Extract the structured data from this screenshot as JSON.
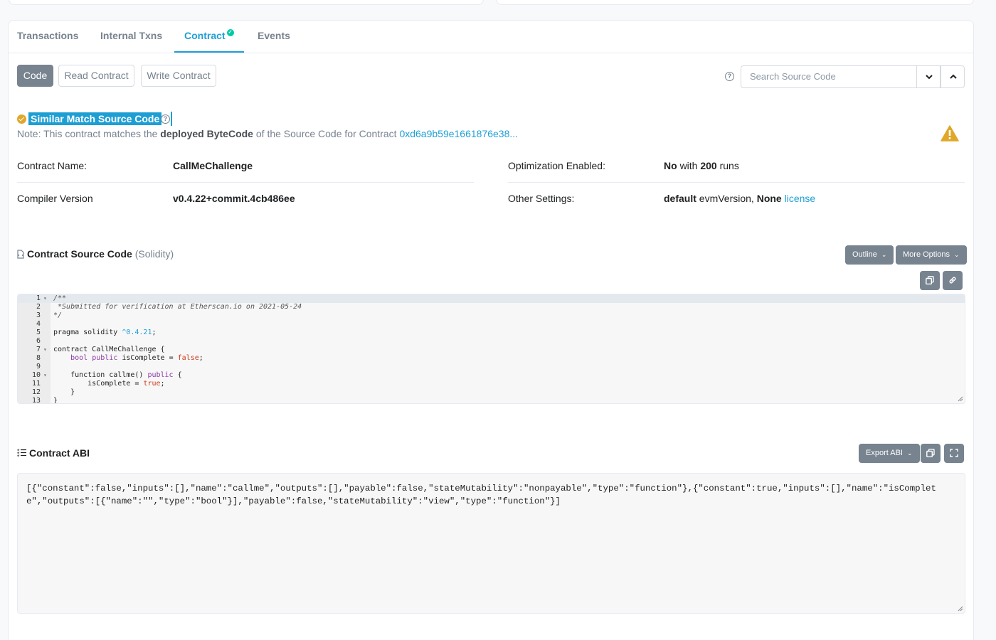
{
  "tabs": [
    {
      "label": "Transactions"
    },
    {
      "label": "Internal Txns"
    },
    {
      "label": "Contract",
      "verified": true
    },
    {
      "label": "Events"
    }
  ],
  "subtabs": {
    "code": "Code",
    "read": "Read Contract",
    "write": "Write Contract"
  },
  "search": {
    "placeholder": "Search Source Code"
  },
  "match": {
    "title": "Similar Match Source Code",
    "note_prefix": "Note: This contract matches the",
    "note_bold": "deployed ByteCode",
    "note_mid": "of the Source Code for Contract",
    "note_link": "0xd6a9b59e1661876e38..."
  },
  "details": {
    "contract_name_label": "Contract Name:",
    "contract_name": "CallMeChallenge",
    "compiler_label": "Compiler Version",
    "compiler": "v0.4.22+commit.4cb486ee",
    "optimization_label": "Optimization Enabled:",
    "optimization_value": "No",
    "optimization_with": "with",
    "optimization_runs": "200",
    "optimization_runs_label": "runs",
    "other_label": "Other Settings:",
    "other_default": "default",
    "other_evm": "evmVersion,",
    "other_none": "None",
    "other_license": "license"
  },
  "source": {
    "title": "Contract Source Code",
    "lang": "(Solidity)",
    "outline": "Outline",
    "more_options": "More Options",
    "lines": [
      {
        "n": "1",
        "fold": true,
        "text": "/**"
      },
      {
        "n": "2",
        "text": " *Submitted for verification at Etherscan.io on 2021-05-24"
      },
      {
        "n": "3",
        "text": "*/"
      },
      {
        "n": "4",
        "text": ""
      },
      {
        "n": "5",
        "text": "pragma solidity ^0.4.21;"
      },
      {
        "n": "6",
        "text": ""
      },
      {
        "n": "7",
        "fold": true,
        "text": "contract CallMeChallenge {"
      },
      {
        "n": "8",
        "text": "    bool public isComplete = false;"
      },
      {
        "n": "9",
        "text": ""
      },
      {
        "n": "10",
        "fold": true,
        "text": "    function callme() public {"
      },
      {
        "n": "11",
        "text": "        isComplete = true;"
      },
      {
        "n": "12",
        "text": "    }"
      },
      {
        "n": "13",
        "text": "}"
      }
    ]
  },
  "abi": {
    "title": "Contract ABI",
    "export": "Export ABI",
    "text": "[{\"constant\":false,\"inputs\":[],\"name\":\"callme\",\"outputs\":[],\"payable\":false,\"stateMutability\":\"nonpayable\",\"type\":\"function\"},{\"constant\":true,\"inputs\":[],\"name\":\"isComplete\",\"outputs\":[{\"name\":\"\",\"type\":\"bool\"}],\"payable\":false,\"stateMutability\":\"view\",\"type\":\"function\"}]"
  },
  "colors": {
    "accent": "#1e9fd4",
    "verified": "#00c9a7",
    "warning": "#e0a72a",
    "button_dark": "#77838f"
  }
}
